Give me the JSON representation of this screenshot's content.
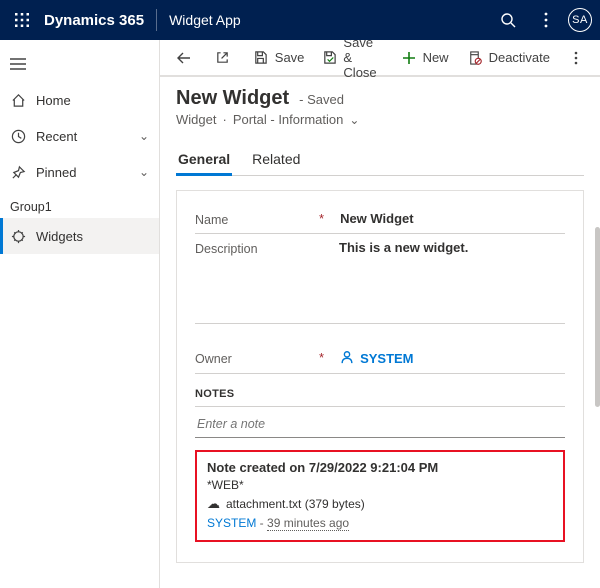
{
  "top": {
    "brand": "Dynamics 365",
    "app": "Widget App",
    "avatar": "SA"
  },
  "sidebar": {
    "home": "Home",
    "recent": "Recent",
    "pinned": "Pinned",
    "group1": "Group1",
    "widgets": "Widgets"
  },
  "cmd": {
    "save": "Save",
    "save_close": "Save & Close",
    "new": "New",
    "deactivate": "Deactivate"
  },
  "record": {
    "title": "New Widget",
    "status": "- Saved",
    "entity": "Widget",
    "form": "Portal - Information"
  },
  "tabs": {
    "general": "General",
    "related": "Related"
  },
  "fields": {
    "name_label": "Name",
    "name_value": "New Widget",
    "desc_label": "Description",
    "desc_value": "This is a new widget.",
    "owner_label": "Owner",
    "owner_value": "SYSTEM"
  },
  "notes": {
    "header": "NOTES",
    "placeholder": "Enter a note",
    "title": "Note created on 7/29/2022 9:21:04 PM",
    "web": "*WEB*",
    "attachment": "attachment.txt (379 bytes)",
    "user": "SYSTEM",
    "sep": " - ",
    "age": "39 minutes ago"
  }
}
